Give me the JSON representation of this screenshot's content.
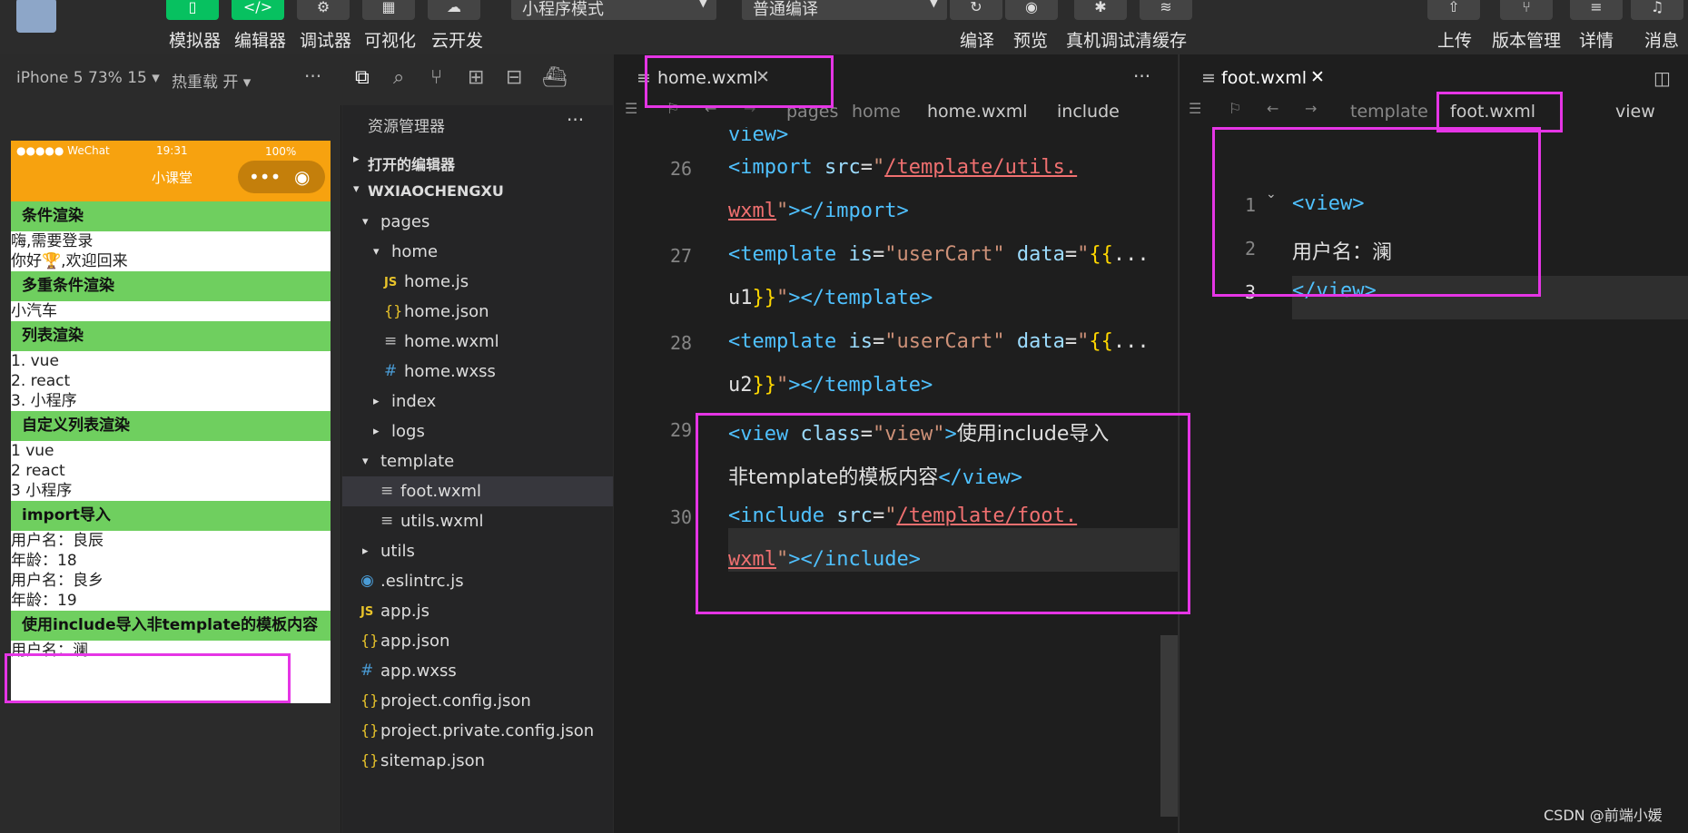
{
  "toolbar": {
    "left_buttons": [
      "模拟器",
      "编辑器",
      "调试器",
      "可视化",
      "云开发"
    ],
    "mode_select": "小程序模式",
    "compile_select": "普通编译",
    "mid_buttons": [
      "编译",
      "预览",
      "真机调试",
      "清缓存"
    ],
    "right_buttons": [
      "上传",
      "版本管理",
      "详情",
      "消息"
    ]
  },
  "simbar": {
    "device": "iPhone 5 73% 15 ▾",
    "hotreload": "热重载 开 ▾",
    "more": "···"
  },
  "phone": {
    "carrier": "●●●●● WeChat",
    "time": "19:31",
    "battery": "100%",
    "title": "小课堂",
    "capsule_dots": "•••",
    "sections": [
      {
        "title": "条件渲染",
        "lines": [
          "嗨,需要登录",
          "你好🏆,欢迎回来"
        ]
      },
      {
        "title": "多重条件渲染",
        "lines": [
          "小汽车"
        ]
      },
      {
        "title": "列表渲染",
        "lines": [
          "1. vue",
          "2. react",
          "3. 小程序"
        ]
      },
      {
        "title": "自定义列表渲染",
        "lines": [
          "1 vue",
          "2 react",
          "3 小程序"
        ]
      },
      {
        "title": "import导入",
        "lines": [
          "用户名：良辰",
          "年龄：18",
          "用户名：良乡",
          "年龄：19"
        ]
      },
      {
        "title": "使用include导入非template的模板内容",
        "lines": [
          "用户名：澜"
        ]
      }
    ]
  },
  "explorer": {
    "title": "资源管理器",
    "more": "···",
    "open_editors": "打开的编辑器",
    "project": "WXIAOCHENGXU",
    "tree": [
      {
        "label": "pages",
        "arrow": "▾",
        "icon": ""
      },
      {
        "label": "home",
        "arrow": "▾",
        "icon": ""
      },
      {
        "label": "home.js",
        "arrow": "",
        "icon": "JS"
      },
      {
        "label": "home.json",
        "arrow": "",
        "icon": "{}"
      },
      {
        "label": "home.wxml",
        "arrow": "",
        "icon": "≡"
      },
      {
        "label": "home.wxss",
        "arrow": "",
        "icon": "#"
      },
      {
        "label": "index",
        "arrow": "▸",
        "icon": ""
      },
      {
        "label": "logs",
        "arrow": "▸",
        "icon": ""
      },
      {
        "label": "template",
        "arrow": "▾",
        "icon": ""
      },
      {
        "label": "foot.wxml",
        "arrow": "",
        "icon": "≡"
      },
      {
        "label": "utils.wxml",
        "arrow": "",
        "icon": "≡"
      },
      {
        "label": "utils",
        "arrow": "▸",
        "icon": ""
      },
      {
        "label": ".eslintrc.js",
        "arrow": "",
        "icon": "◉"
      },
      {
        "label": "app.js",
        "arrow": "",
        "icon": "JS"
      },
      {
        "label": "app.json",
        "arrow": "",
        "icon": "{}"
      },
      {
        "label": "app.wxss",
        "arrow": "",
        "icon": "#"
      },
      {
        "label": "project.config.json",
        "arrow": "",
        "icon": "{}"
      },
      {
        "label": "project.private.config.json",
        "arrow": "",
        "icon": "{}"
      },
      {
        "label": "sitemap.json",
        "arrow": "",
        "icon": "{}"
      }
    ]
  },
  "editor1": {
    "tab": "home.wxml",
    "more": "···",
    "breadcrumb": [
      "pages",
      "home",
      "home.wxml",
      "include"
    ],
    "line_numbers": [
      "26",
      "27",
      "28",
      "29",
      "30"
    ],
    "top_fragment": "view>"
  },
  "editor2": {
    "tab": "foot.wxml",
    "breadcrumb": [
      "template",
      "foot.wxml",
      "view"
    ],
    "line_numbers": [
      "1",
      "2",
      "3"
    ],
    "line2_text": "用户名：澜"
  },
  "watermark": "CSDN @前端小媛"
}
